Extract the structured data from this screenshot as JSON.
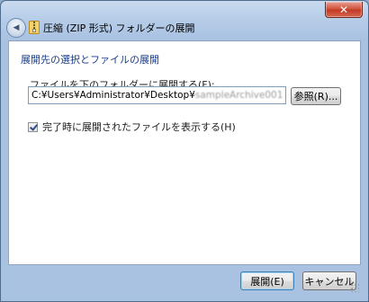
{
  "window": {
    "title": "圧縮 (ZIP 形式) フォルダーの展開",
    "close_glyph": "✕",
    "back_glyph": "◀"
  },
  "content": {
    "heading": "展開先の選択とファイルの展開",
    "field_label": "ファイルを下のフォルダーに展開する(F):",
    "path_value_visible": "C:¥Users¥Administrator¥Desktop¥",
    "path_value_blurred": "sampleArchive001",
    "browse_label": "参照(R)...",
    "checkbox_label": "完了時に展開されたファイルを表示する(H)",
    "checkbox_checked": true
  },
  "footer": {
    "extract_label": "展開(E)",
    "cancel_label": "キャンセル"
  },
  "colors": {
    "heading": "#1a3e8c",
    "frame": "#a9c2e2",
    "close_button": "#c33a26",
    "default_button_border": "#3c7fb1"
  },
  "icons": {
    "back": "back-arrow-icon",
    "zip": "zip-folder-icon",
    "close": "close-icon",
    "check": "checkmark-icon",
    "grip": "resize-grip-icon"
  }
}
